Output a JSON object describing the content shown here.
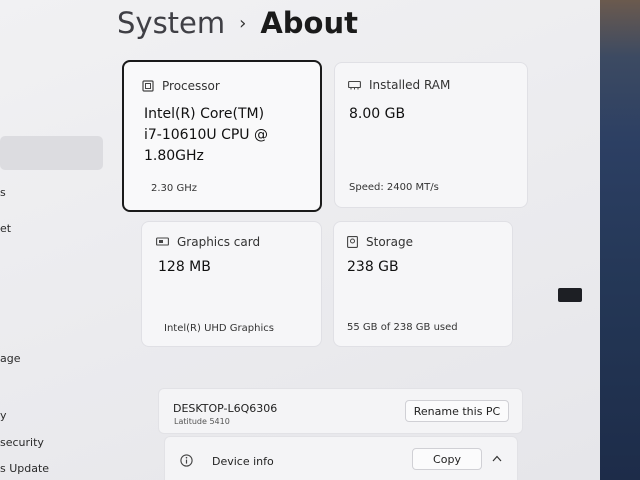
{
  "breadcrumb": {
    "parent": "System",
    "separator": "›",
    "current": "About"
  },
  "sidebar": {
    "items": [
      {
        "label": "s"
      },
      {
        "label": "et"
      },
      {
        "label": "age"
      },
      {
        "label": "y"
      },
      {
        "label": "security"
      },
      {
        "label": "s Update"
      }
    ]
  },
  "cards": {
    "processor": {
      "label": "Processor",
      "value_lines": [
        "Intel(R) Core(TM)",
        "i7-10610U CPU @",
        "1.80GHz"
      ],
      "detail": "2.30 GHz",
      "icon": "processor-icon"
    },
    "ram": {
      "label": "Installed RAM",
      "value": "8.00 GB",
      "detail": "Speed: 2400 MT/s",
      "icon": "ram-icon"
    },
    "graphics": {
      "label": "Graphics card",
      "value": "128 MB",
      "detail": "Intel(R) UHD Graphics",
      "icon": "graphics-card-icon"
    },
    "storage": {
      "label": "Storage",
      "value": "238 GB",
      "detail": "55 GB of 238 GB used",
      "icon": "storage-icon"
    }
  },
  "device": {
    "name": "DESKTOP-L6Q6306",
    "model": "Latitude 5410",
    "rename_label": "Rename this PC"
  },
  "device_info": {
    "label": "Device info",
    "copy_label": "Copy",
    "icon": "info-icon"
  }
}
